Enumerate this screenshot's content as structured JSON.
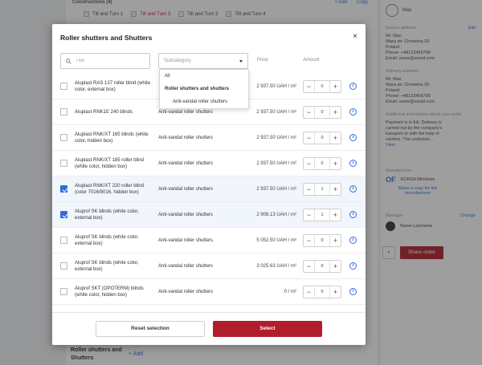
{
  "background": {
    "constructions": {
      "caption": "Constructions (4)",
      "add_label": "+ Add",
      "copy_label": "Copy",
      "tabs": [
        "Tilt and Turn 1",
        "Tilt and Turn 3",
        "Tilt and Turn 3",
        "Tilt and Turn 4"
      ]
    },
    "sidebar": {
      "user_name": "Max",
      "invoice": {
        "title": "Invoice address",
        "edit_label": "Edit",
        "lines": [
          "Mr. Max",
          "Wara str. Chmielna 29",
          "Poland",
          "Phone: +48123456789",
          "Email: some@email.com"
        ]
      },
      "delivery": {
        "title": "Delivery address",
        "lines": [
          "Mr. Max",
          "Wara str. Chmielna 29",
          "Poland",
          "Phone: +48123456789",
          "Email: some@email.com"
        ]
      },
      "additional": {
        "title": "Additional information about your order",
        "lines": [
          "Payment is in full. Delivery is",
          "carried out by the company's",
          "transport or with the help of",
          "carriers. The customer..."
        ],
        "view_label": "View"
      },
      "manufacturer": {
        "title": "Manufacturer",
        "logo": "OF",
        "name": "KORSA Windows",
        "link_label": "Make a copy for the manufacturer"
      },
      "manager": {
        "title": "Manager",
        "change_label": "Change",
        "name": "Name Lastname"
      },
      "share_label": "Share order"
    },
    "bottom": {
      "title": "Roller shutters and Shutters",
      "add_label": "+ Add"
    }
  },
  "modal": {
    "title": "Roller shutters and Shutters",
    "close_glyph": "×",
    "search_placeholder": "Title",
    "subcategory_placeholder": "Subcategory",
    "col_price": "Price",
    "col_amount": "Amount",
    "dropdown": [
      {
        "label": "All",
        "style": "normal"
      },
      {
        "label": "Roller shutters and shutters",
        "style": "bold"
      },
      {
        "label": "Anti-vandal roller shutters",
        "style": "indent"
      }
    ],
    "rows": [
      {
        "name": "Aluplast RAS 137 roller blind (white color, external box)",
        "category": "",
        "price": "2 937.50 UAH / m²",
        "qty": "0",
        "checked": false
      },
      {
        "name": "Aluplast RNK1E 240 blinds",
        "category": "Anti-vandal roller shutters",
        "price": "2 937.50 UAH / m²",
        "qty": "0",
        "checked": false
      },
      {
        "name": "Aluplast RNK/XT 165 blinds (white color, hidden box)",
        "category": "Anti-vandal roller shutters",
        "price": "2 937.50 UAH / m²",
        "qty": "0",
        "checked": false
      },
      {
        "name": "Aluplast RNK/XT 185 roller blind (white color, hidden box)",
        "category": "Anti-vandal roller shutters",
        "price": "2 937.50 UAH / m²",
        "qty": "0",
        "checked": false
      },
      {
        "name": "Aluplast RNK/XT 220 roller blind (color 7016/9016, hidden box)",
        "category": "Anti-vandal roller shutters",
        "price": "2 937.50 UAH / m²",
        "qty": "1",
        "checked": true
      },
      {
        "name": "Aluprof SK blinds (white color, external box)",
        "category": "Anti-vandal roller shutters",
        "price": "2 908.13 UAH / m²",
        "qty": "1",
        "checked": true
      },
      {
        "name": "Aluprof SK blinds (white color, external box)",
        "category": "Anti-vandal roller shutters",
        "price": "5 052.50 UAH / m²",
        "qty": "0",
        "checked": false
      },
      {
        "name": "Aluprof SK blinds (white color, external box)",
        "category": "Anti-vandal roller shutters",
        "price": "3 025.63 UAH / m²",
        "qty": "0",
        "checked": false
      },
      {
        "name": "Aluprof SKT (OPOTERM) blinds (white color, hidden box)",
        "category": "Anti-vandal roller shutters",
        "price": "0 / m²",
        "qty": "0",
        "checked": false
      }
    ],
    "reset_label": "Reset selection",
    "select_label": "Select"
  },
  "colors": {
    "accent": "#b11d2b",
    "link": "#2f6fd6",
    "selected_row": "#f1f6fc"
  }
}
